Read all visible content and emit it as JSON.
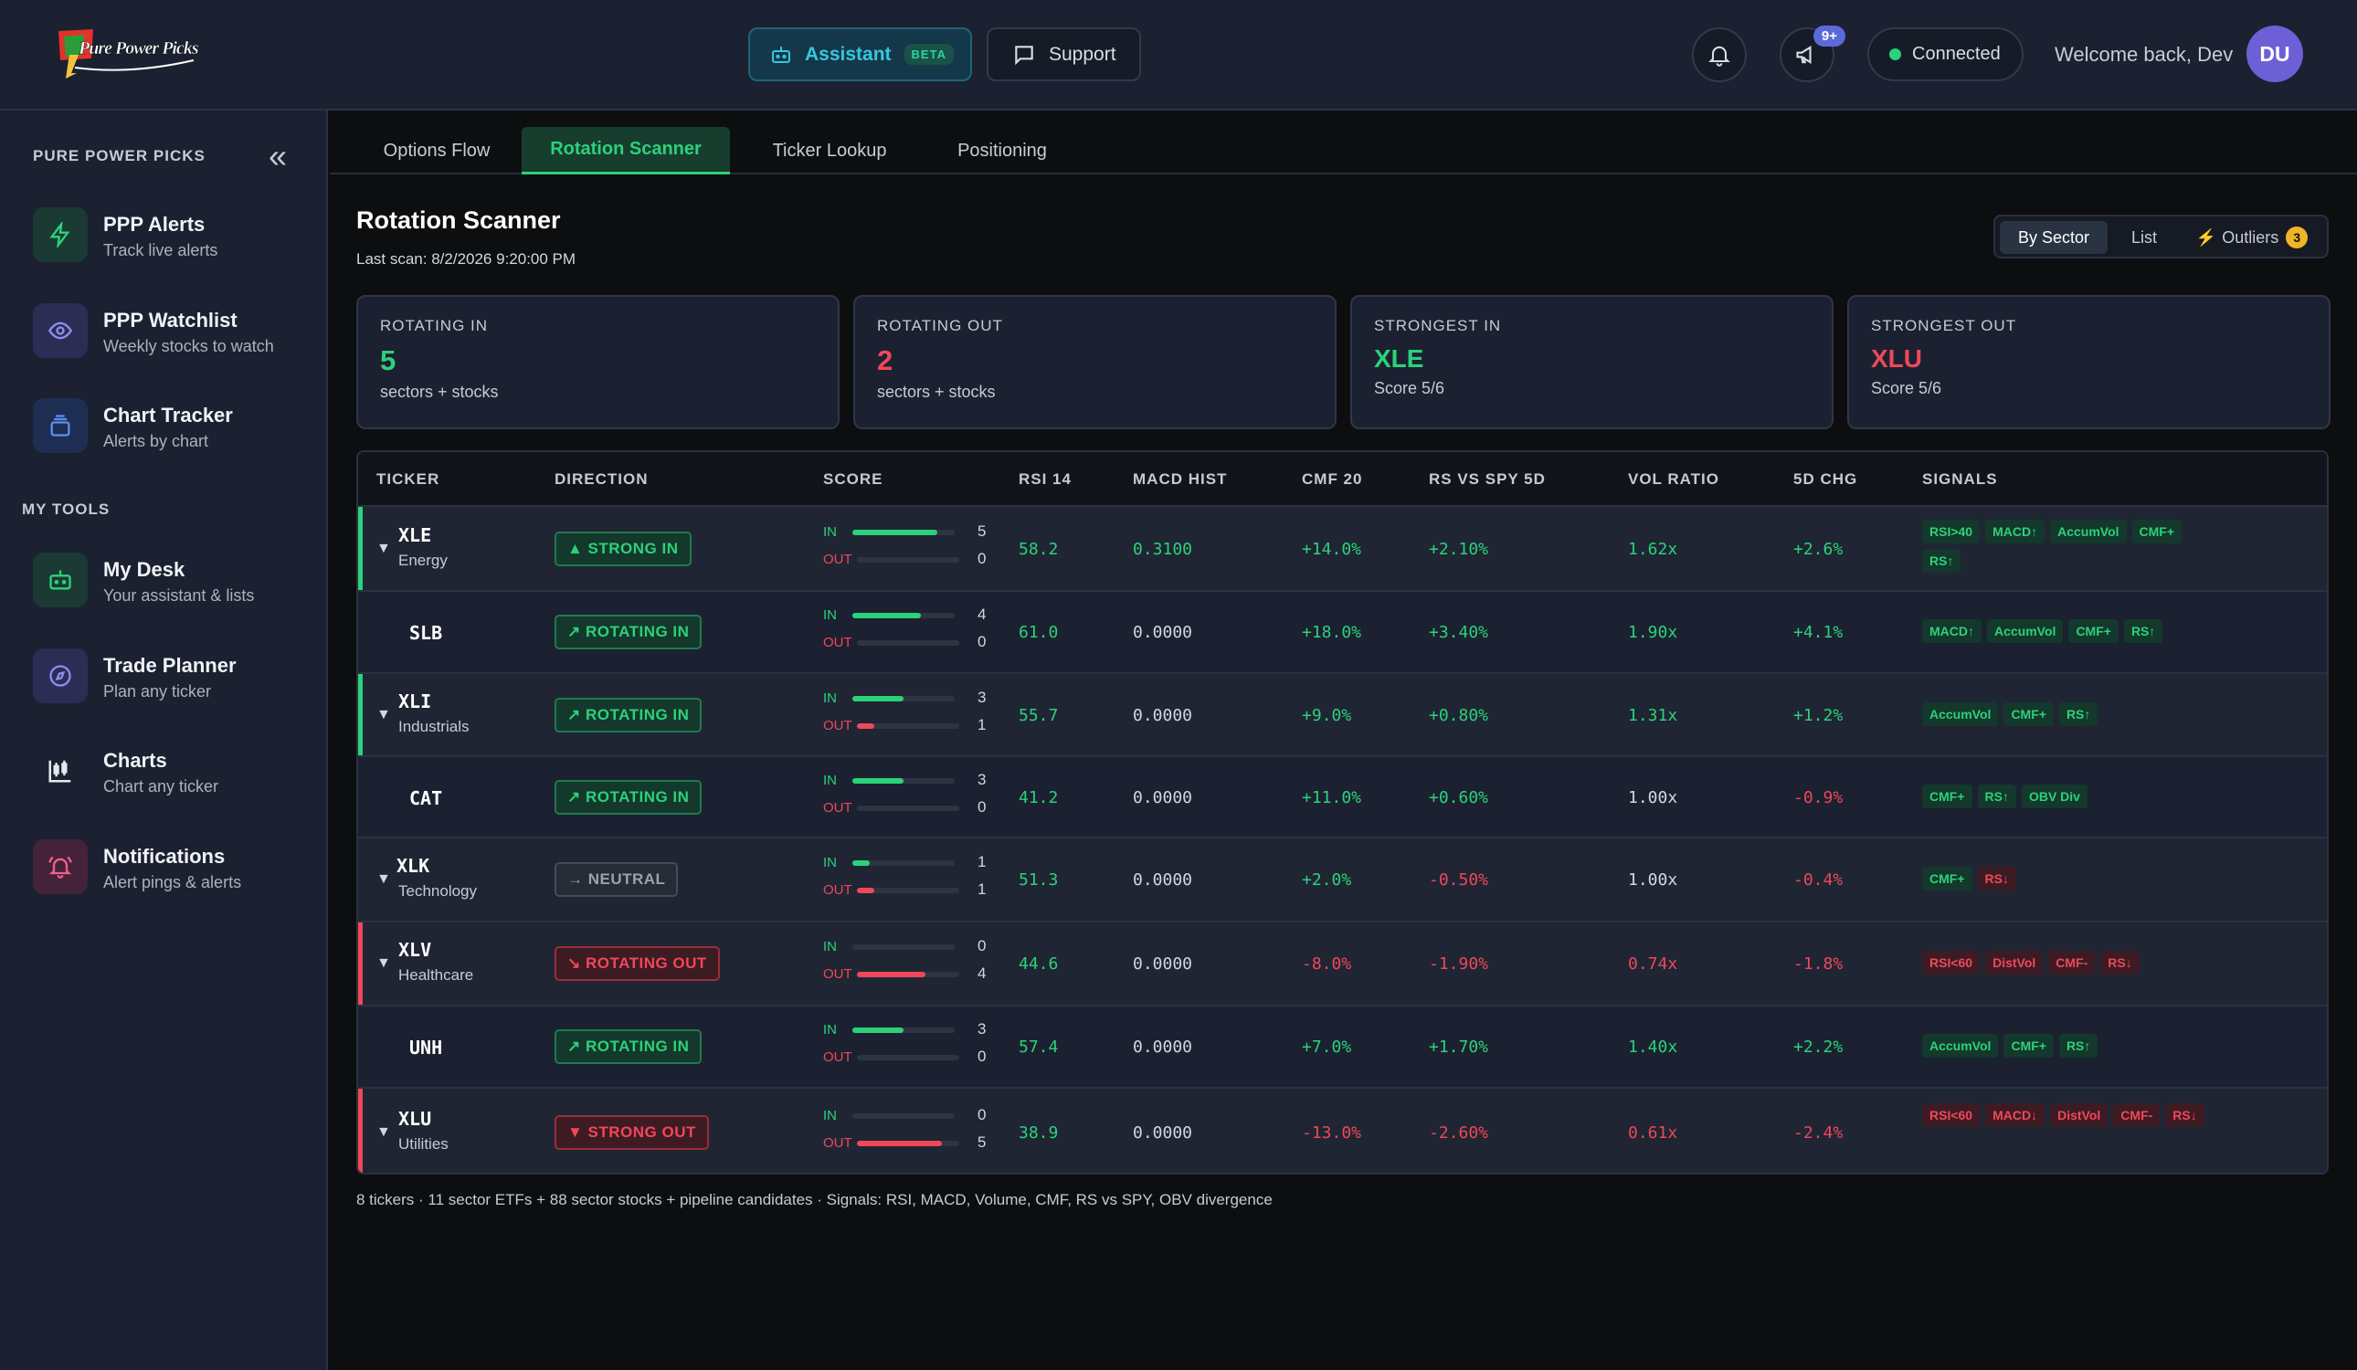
{
  "header": {
    "logo_text": "Pure Power Picks",
    "assistant_label": "Assistant",
    "assistant_badge": "BETA",
    "support_label": "Support",
    "notif_badge": "9+",
    "connected_label": "Connected",
    "welcome": "Welcome back, Dev",
    "avatar_initials": "DU"
  },
  "sidebar": {
    "heading": "PURE POWER PICKS",
    "tools_heading": "MY TOOLS",
    "items": [
      {
        "title": "PPP Alerts",
        "sub": "Track live alerts",
        "icon": "lightning-icon",
        "color": "#2bd27a"
      },
      {
        "title": "PPP Watchlist",
        "sub": "Weekly stocks to watch",
        "icon": "eye-icon",
        "color": "#8b8ff0"
      },
      {
        "title": "Chart Tracker",
        "sub": "Alerts by chart",
        "icon": "layers-icon",
        "color": "#5b8ff0"
      },
      {
        "title": "My Desk",
        "sub": "Your assistant & lists",
        "icon": "robot-icon",
        "color": "#2bd27a"
      },
      {
        "title": "Trade Planner",
        "sub": "Plan any ticker",
        "icon": "compass-icon",
        "color": "#8b8ff0"
      },
      {
        "title": "Charts",
        "sub": "Chart any ticker",
        "icon": "candlestick-icon",
        "color": "#e6e9ee"
      },
      {
        "title": "Notifications",
        "sub": "Alert pings & alerts",
        "icon": "bell-ring-icon",
        "color": "#f0608a"
      }
    ]
  },
  "tabs": [
    "Options Flow",
    "Rotation Scanner",
    "Ticker Lookup",
    "Positioning"
  ],
  "page": {
    "title": "Rotation Scanner",
    "last_scan": "Last scan: 8/2/2026 9:20:00 PM"
  },
  "view_toggle": {
    "by_sector": "By Sector",
    "list": "List",
    "outliers": "Outliers",
    "outliers_count": "3"
  },
  "cards": [
    {
      "label": "ROTATING IN",
      "value": "5",
      "sub": "sectors + stocks",
      "tone": "green"
    },
    {
      "label": "ROTATING OUT",
      "value": "2",
      "sub": "sectors + stocks",
      "tone": "red"
    },
    {
      "label": "STRONGEST IN",
      "value": "XLE",
      "sub": "Score 5/6",
      "tone": "green"
    },
    {
      "label": "STRONGEST OUT",
      "value": "XLU",
      "sub": "Score 5/6",
      "tone": "red"
    }
  ],
  "table": {
    "headers": [
      "TICKER",
      "DIRECTION",
      "SCORE",
      "RSI 14",
      "MACD HIST",
      "CMF 20",
      "RS VS SPY 5D",
      "VOL RATIO",
      "5D CHG",
      "SIGNALS"
    ],
    "in_label": "IN",
    "out_label": "OUT",
    "caret": "▼",
    "rows": [
      {
        "ticker": "XLE",
        "sector": "Energy",
        "is_sector": true,
        "bar": "green",
        "direction": "▲ STRONG IN",
        "dir_tone": "in",
        "in": 5,
        "out": 0,
        "rsi": "58.2",
        "rsi_tone": "green",
        "macd": "0.3100",
        "macd_tone": "green",
        "cmf": "+14.0%",
        "cmf_tone": "green",
        "rs": "+2.10%",
        "rs_tone": "green",
        "vol": "1.62x",
        "vol_tone": "green",
        "chg": "+2.6%",
        "chg_tone": "green",
        "signals": [
          {
            "t": "RSI>40",
            "c": "g"
          },
          {
            "t": "MACD↑",
            "c": "g"
          },
          {
            "t": "AccumVol",
            "c": "g"
          },
          {
            "t": "CMF+",
            "c": "g"
          },
          {
            "t": "RS↑",
            "c": "g"
          }
        ]
      },
      {
        "ticker": "SLB",
        "sector": "",
        "is_sector": false,
        "bar": "",
        "direction": "↗ ROTATING IN",
        "dir_tone": "in",
        "in": 4,
        "out": 0,
        "rsi": "61.0",
        "rsi_tone": "green",
        "macd": "0.0000",
        "macd_tone": "neut",
        "cmf": "+18.0%",
        "cmf_tone": "green",
        "rs": "+3.40%",
        "rs_tone": "green",
        "vol": "1.90x",
        "vol_tone": "green",
        "chg": "+4.1%",
        "chg_tone": "green",
        "signals": [
          {
            "t": "MACD↑",
            "c": "g"
          },
          {
            "t": "AccumVol",
            "c": "g"
          },
          {
            "t": "CMF+",
            "c": "g"
          },
          {
            "t": "RS↑",
            "c": "g"
          }
        ]
      },
      {
        "ticker": "XLI",
        "sector": "Industrials",
        "is_sector": true,
        "bar": "green",
        "direction": "↗ ROTATING IN",
        "dir_tone": "in",
        "in": 3,
        "out": 1,
        "rsi": "55.7",
        "rsi_tone": "green",
        "macd": "0.0000",
        "macd_tone": "neut",
        "cmf": "+9.0%",
        "cmf_tone": "green",
        "rs": "+0.80%",
        "rs_tone": "green",
        "vol": "1.31x",
        "vol_tone": "green",
        "chg": "+1.2%",
        "chg_tone": "green",
        "signals": [
          {
            "t": "AccumVol",
            "c": "g"
          },
          {
            "t": "CMF+",
            "c": "g"
          },
          {
            "t": "RS↑",
            "c": "g"
          }
        ]
      },
      {
        "ticker": "CAT",
        "sector": "",
        "is_sector": false,
        "bar": "",
        "direction": "↗ ROTATING IN",
        "dir_tone": "in",
        "in": 3,
        "out": 0,
        "rsi": "41.2",
        "rsi_tone": "green",
        "macd": "0.0000",
        "macd_tone": "neut",
        "cmf": "+11.0%",
        "cmf_tone": "green",
        "rs": "+0.60%",
        "rs_tone": "green",
        "vol": "1.00x",
        "vol_tone": "neut",
        "chg": "-0.9%",
        "chg_tone": "red",
        "signals": [
          {
            "t": "CMF+",
            "c": "g"
          },
          {
            "t": "RS↑",
            "c": "g"
          },
          {
            "t": "OBV Div",
            "c": "g"
          }
        ]
      },
      {
        "ticker": "XLK",
        "sector": "Technology",
        "is_sector": true,
        "bar": "",
        "direction": "→ NEUTRAL",
        "dir_tone": "neu",
        "in": 1,
        "out": 1,
        "rsi": "51.3",
        "rsi_tone": "green",
        "macd": "0.0000",
        "macd_tone": "neut",
        "cmf": "+2.0%",
        "cmf_tone": "green",
        "rs": "-0.50%",
        "rs_tone": "red",
        "vol": "1.00x",
        "vol_tone": "neut",
        "chg": "-0.4%",
        "chg_tone": "red",
        "signals": [
          {
            "t": "CMF+",
            "c": "g"
          },
          {
            "t": "RS↓",
            "c": "r"
          }
        ]
      },
      {
        "ticker": "XLV",
        "sector": "Healthcare",
        "is_sector": true,
        "bar": "red",
        "direction": "↘ ROTATING OUT",
        "dir_tone": "out",
        "in": 0,
        "out": 4,
        "rsi": "44.6",
        "rsi_tone": "green",
        "macd": "0.0000",
        "macd_tone": "neut",
        "cmf": "-8.0%",
        "cmf_tone": "red",
        "rs": "-1.90%",
        "rs_tone": "red",
        "vol": "0.74x",
        "vol_tone": "red",
        "chg": "-1.8%",
        "chg_tone": "red",
        "signals": [
          {
            "t": "RSI<60",
            "c": "r"
          },
          {
            "t": "DistVol",
            "c": "r"
          },
          {
            "t": "CMF-",
            "c": "r"
          },
          {
            "t": "RS↓",
            "c": "r"
          }
        ]
      },
      {
        "ticker": "UNH",
        "sector": "",
        "is_sector": false,
        "bar": "",
        "direction": "↗ ROTATING IN",
        "dir_tone": "in",
        "in": 3,
        "out": 0,
        "rsi": "57.4",
        "rsi_tone": "green",
        "macd": "0.0000",
        "macd_tone": "neut",
        "cmf": "+7.0%",
        "cmf_tone": "green",
        "rs": "+1.70%",
        "rs_tone": "green",
        "vol": "1.40x",
        "vol_tone": "green",
        "chg": "+2.2%",
        "chg_tone": "green",
        "signals": [
          {
            "t": "AccumVol",
            "c": "g"
          },
          {
            "t": "CMF+",
            "c": "g"
          },
          {
            "t": "RS↑",
            "c": "g"
          }
        ]
      },
      {
        "ticker": "XLU",
        "sector": "Utilities",
        "is_sector": true,
        "bar": "red",
        "direction": "▼ STRONG OUT",
        "dir_tone": "out",
        "in": 0,
        "out": 5,
        "rsi": "38.9",
        "rsi_tone": "green",
        "macd": "0.0000",
        "macd_tone": "neut",
        "cmf": "-13.0%",
        "cmf_tone": "red",
        "rs": "-2.60%",
        "rs_tone": "red",
        "vol": "0.61x",
        "vol_tone": "red",
        "chg": "-2.4%",
        "chg_tone": "red",
        "signals": [
          {
            "t": "RSI<60",
            "c": "r"
          },
          {
            "t": "MACD↓",
            "c": "r"
          },
          {
            "t": "DistVol",
            "c": "r"
          },
          {
            "t": "CMF-",
            "c": "r"
          },
          {
            "t": "RS↓",
            "c": "r"
          }
        ]
      }
    ]
  },
  "footer": "8 tickers · 11 sector ETFs + 88 sector stocks + pipeline candidates · Signals: RSI, MACD, Volume, CMF, RS vs SPY, OBV divergence",
  "colors": {
    "accent_green": "#2bd27a",
    "accent_red": "#f0475a",
    "accent_cyan": "#37c6df",
    "panel": "#1b2130",
    "background": "#0d0e10"
  }
}
